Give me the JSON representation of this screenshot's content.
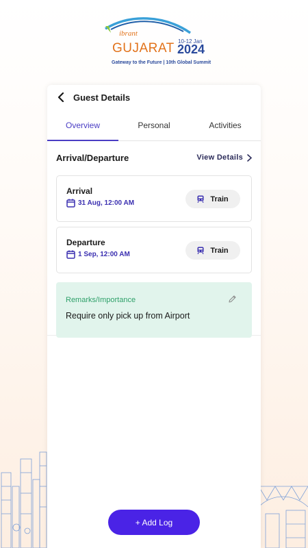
{
  "logo": {
    "brand": "ibrant",
    "name": "GUJARAT",
    "dates": "10-12 Jan",
    "year": "2024",
    "tagline": "Gateway to the Future | 10th Global Summit"
  },
  "header": {
    "title": "Guest Details"
  },
  "tabs": [
    {
      "label": "Overview",
      "active": true
    },
    {
      "label": "Personal",
      "active": false
    },
    {
      "label": "Activities",
      "active": false
    }
  ],
  "section": {
    "title": "Arrival/Departure",
    "link_label": "View Details"
  },
  "legs": [
    {
      "title": "Arrival",
      "date": "31 Aug, 12:00 AM",
      "mode": "Train"
    },
    {
      "title": "Departure",
      "date": "1 Sep, 12:00 AM",
      "mode": "Train"
    }
  ],
  "remarks": {
    "label": "Remarks/Importance",
    "text": "Require only pick up from Airport"
  },
  "actions": {
    "add_log_label": "+ Add Log"
  },
  "colors": {
    "accent": "#4a3dc4",
    "button": "#4a23e6",
    "remarks_bg": "#e1f4ec",
    "remarks_label": "#2fa06a",
    "brand_orange": "#e2731b",
    "brand_blue": "#2a4a9c"
  },
  "icons": {
    "back": "chevron-left-icon",
    "view_details": "chevron-right-icon",
    "date": "calendar-icon",
    "mode": "train-icon",
    "edit": "pencil-icon"
  }
}
